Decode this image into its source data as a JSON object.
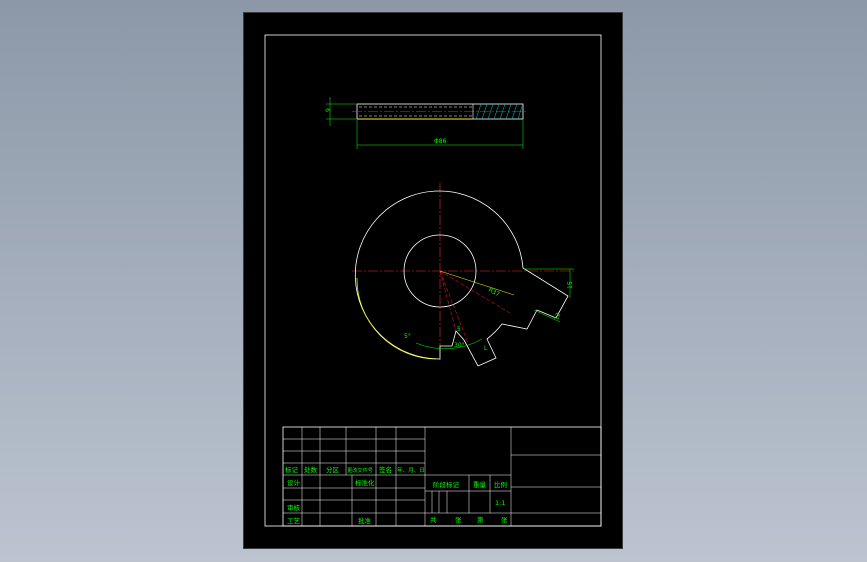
{
  "drawing": {
    "side_view": {
      "thickness_label": "9",
      "length_label": "Φ86"
    },
    "front_view": {
      "radius_label": "R37",
      "slot_depth_label": "15",
      "slot_width_label": "12",
      "angle_small_label": "5°",
      "angle_large_label": "30°",
      "slot_width_label_2": "5",
      "slot_mark_label": "L"
    }
  },
  "title_block": {
    "rev_headers": [
      "标记",
      "处数",
      "分区",
      "更改文件号",
      "签名",
      "年、月、日"
    ],
    "role_design": "设计",
    "role_standard": "标准化",
    "role_check": "审核",
    "role_process": "工艺",
    "role_approve": "批准",
    "stage_label": "阶段标记",
    "weight_label": "重量",
    "scale_label": "比例",
    "scale_value": "1:1",
    "sheets_total": "共",
    "sheets_unit1": "张",
    "sheets_page": "第",
    "sheets_unit2": "张"
  },
  "colors": {
    "background": "#000000",
    "frame": "#ffffff",
    "text": "#00ff00",
    "center_line": "#ff2020",
    "outline": "#ffffff",
    "edge_highlight": "#ffff00",
    "hatch": "#00c8c8"
  }
}
